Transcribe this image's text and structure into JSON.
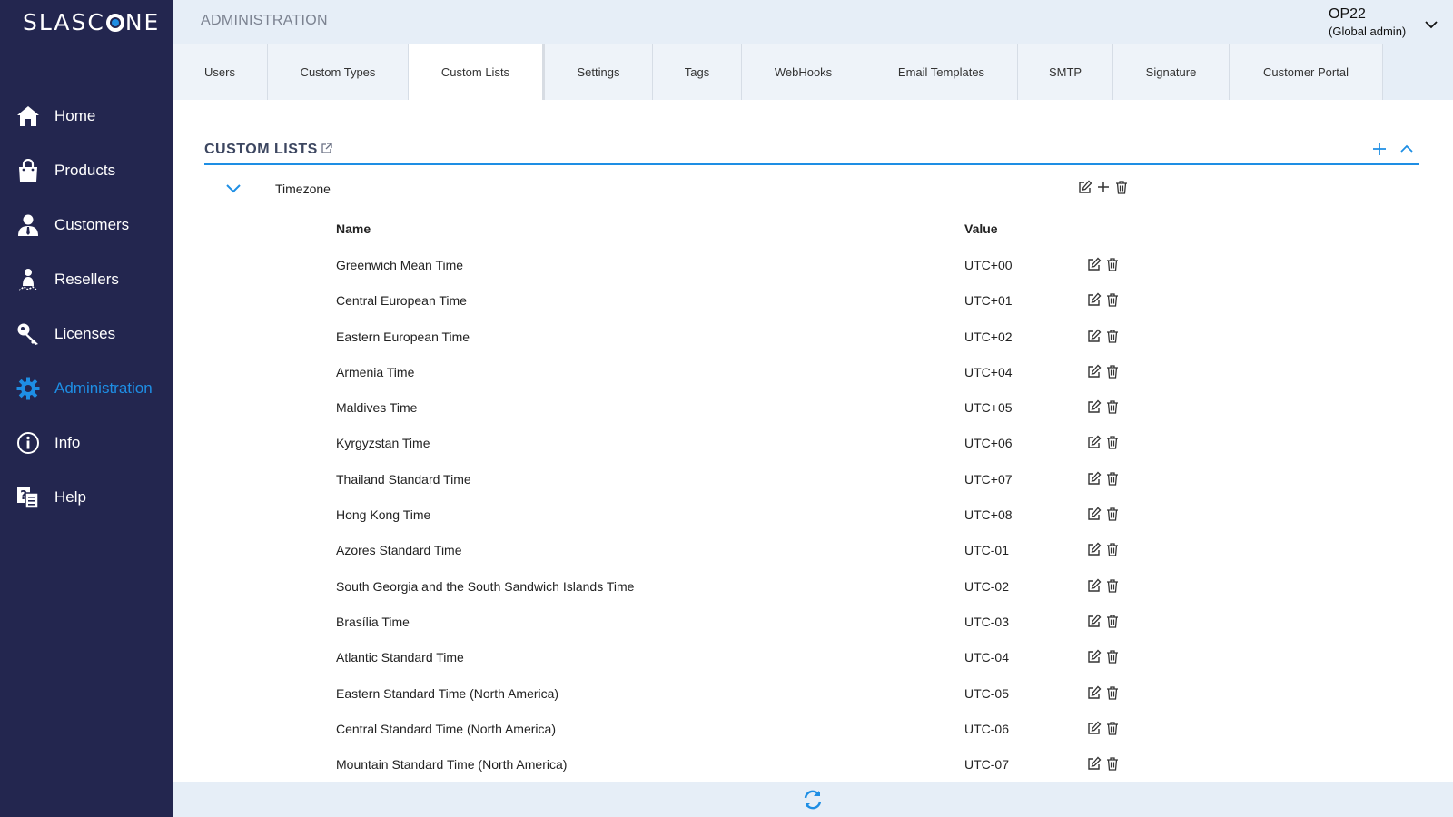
{
  "brand": {
    "logo_text_left": "SLASC",
    "logo_text_right": "NE"
  },
  "sidebar": {
    "items": [
      {
        "label": "Home",
        "icon": "home-icon"
      },
      {
        "label": "Products",
        "icon": "shopping-bag-icon"
      },
      {
        "label": "Customers",
        "icon": "user-tie-icon"
      },
      {
        "label": "Resellers",
        "icon": "reseller-icon"
      },
      {
        "label": "Licenses",
        "icon": "key-icon"
      },
      {
        "label": "Administration",
        "icon": "gear-icon",
        "active": true
      },
      {
        "label": "Info",
        "icon": "info-circle-icon"
      },
      {
        "label": "Help",
        "icon": "help-book-icon"
      }
    ]
  },
  "header": {
    "title": "ADMINISTRATION",
    "user_name": "OP22",
    "user_role": "(Global admin)"
  },
  "tabs": [
    {
      "label": "Users"
    },
    {
      "label": "Custom Types"
    },
    {
      "label": "Custom Lists",
      "active": true
    },
    {
      "label": "Settings"
    },
    {
      "label": "Tags"
    },
    {
      "label": "WebHooks"
    },
    {
      "label": "Email Templates"
    },
    {
      "label": "SMTP"
    },
    {
      "label": "Signature"
    },
    {
      "label": "Customer Portal"
    }
  ],
  "section": {
    "title": "CUSTOM LISTS"
  },
  "list": {
    "name": "Timezone",
    "col_name": "Name",
    "col_value": "Value",
    "rows": [
      {
        "name": "Greenwich Mean Time",
        "value": "UTC+00"
      },
      {
        "name": "Central European Time",
        "value": "UTC+01"
      },
      {
        "name": "Eastern European Time",
        "value": "UTC+02"
      },
      {
        "name": "Armenia Time",
        "value": "UTC+04"
      },
      {
        "name": "Maldives Time",
        "value": "UTC+05"
      },
      {
        "name": "Kyrgyzstan Time",
        "value": "UTC+06"
      },
      {
        "name": "Thailand Standard Time",
        "value": "UTC+07"
      },
      {
        "name": "Hong Kong Time",
        "value": "UTC+08"
      },
      {
        "name": "Azores Standard Time",
        "value": "UTC-01"
      },
      {
        "name": "South Georgia and the South Sandwich Islands Time",
        "value": "UTC-02"
      },
      {
        "name": "Brasília Time",
        "value": "UTC-03"
      },
      {
        "name": "Atlantic Standard Time",
        "value": "UTC-04"
      },
      {
        "name": "Eastern Standard Time (North America)",
        "value": "UTC-05"
      },
      {
        "name": "Central Standard Time (North America)",
        "value": "UTC-06"
      },
      {
        "name": "Mountain Standard Time (North America)",
        "value": "UTC-07"
      }
    ]
  },
  "colors": {
    "sidebar_bg": "#23264f",
    "accent": "#1e8ee4",
    "header_bg": "#e6eef7"
  }
}
